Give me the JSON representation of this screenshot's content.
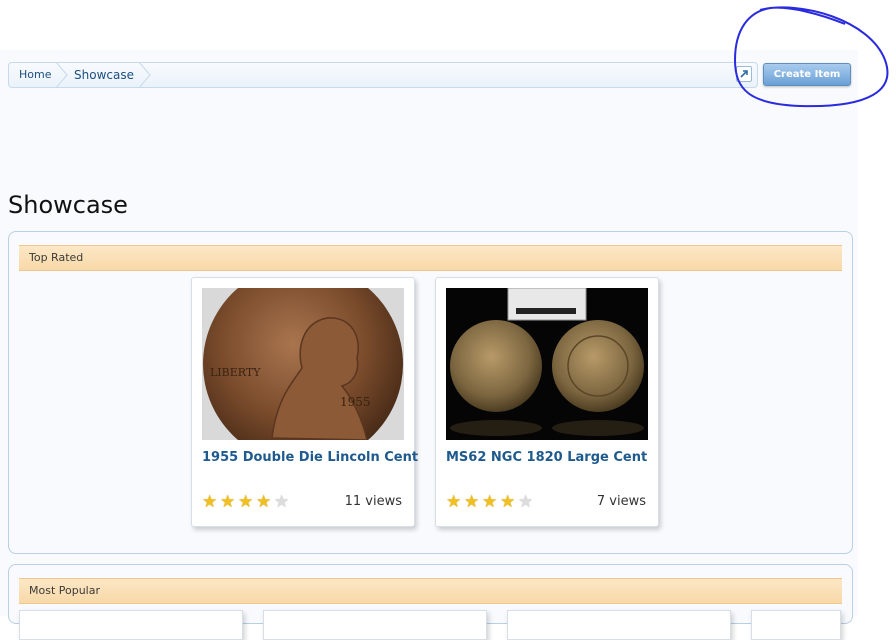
{
  "breadcrumb": {
    "home": "Home",
    "current": "Showcase"
  },
  "toolbar": {
    "create_label": "Create Item",
    "external_icon": "external-link-icon"
  },
  "page": {
    "title": "Showcase"
  },
  "top_rated": {
    "header": "Top Rated",
    "items": [
      {
        "title": "1955 Double Die Lincoln Cent",
        "rating": 4,
        "max_rating": 5,
        "views": "11 views"
      },
      {
        "title": "MS62 NGC 1820 Large Cent",
        "rating": 4,
        "max_rating": 5,
        "views": "7 views"
      }
    ]
  },
  "most_popular": {
    "header": "Most Popular"
  },
  "colors": {
    "accent": "#1f5a8e",
    "section_header": "#f8d9a8",
    "button": "#6aa0d6",
    "annotation": "#2a2adf"
  }
}
